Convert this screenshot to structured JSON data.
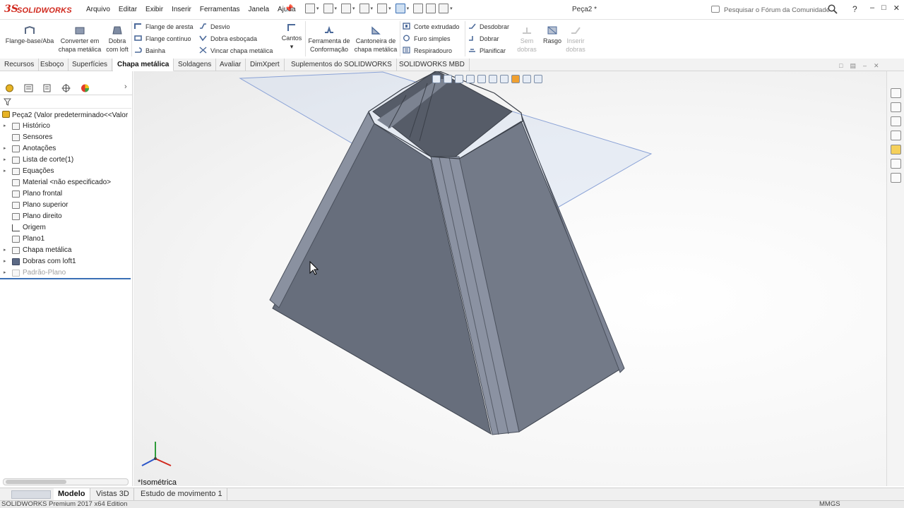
{
  "app": {
    "logo_mark": "3S",
    "logo_text": "SOLIDWORKS",
    "document_title": "Peça2 *",
    "search_placeholder": "Pesquisar o Fórum da Comunidade",
    "help_label": "?"
  },
  "menu": [
    "Arquivo",
    "Editar",
    "Exibir",
    "Inserir",
    "Ferramentas",
    "Janela",
    "Ajuda"
  ],
  "commands": {
    "flange_base": "Flange-base/Aba",
    "converter_1": "Converter em",
    "converter_2": "chapa metálica",
    "dobra_loft_1": "Dobra",
    "dobra_loft_2": "com loft",
    "flange_aresta": "Flange de aresta",
    "flange_continuo": "Flange contínuo",
    "bainha": "Bainha",
    "desvio": "Desvio",
    "dobra_esbocada": "Dobra esboçada",
    "vincar": "Vincar chapa metálica",
    "cantos": "Cantos",
    "ferramenta_1": "Ferramenta de",
    "ferramenta_2": "Conformação",
    "cantoneira_1": "Cantoneira de",
    "cantoneira_2": "chapa metálica",
    "corte_extrudado": "Corte extrudado",
    "furo_simples": "Furo simples",
    "respiradouro": "Respiradouro",
    "desdobrar": "Desdobrar",
    "dobrar": "Dobrar",
    "planificar": "Planificar",
    "sem_dobras_1": "Sem",
    "sem_dobras_2": "dobras",
    "rasgo": "Rasgo",
    "inserir_dobras_1": "Inserir",
    "inserir_dobras_2": "dobras"
  },
  "tabs": [
    "Recursos",
    "Esboço",
    "Superfícies",
    "Chapa metálica",
    "Soldagens",
    "Avaliar",
    "DimXpert",
    "Suplementos do SOLIDWORKS",
    "SOLIDWORKS MBD"
  ],
  "active_tab": "Chapa metálica",
  "tree": {
    "root": "Peça2  (Valor predeterminado<<Valor",
    "items": [
      {
        "label": "Histórico",
        "expandable": true
      },
      {
        "label": "Sensores",
        "expandable": false
      },
      {
        "label": "Anotações",
        "expandable": true
      },
      {
        "label": "Lista de corte(1)",
        "expandable": true
      },
      {
        "label": "Equações",
        "expandable": true
      },
      {
        "label": "Material <não especificado>",
        "expandable": false
      },
      {
        "label": "Plano frontal",
        "expandable": false
      },
      {
        "label": "Plano superior",
        "expandable": false
      },
      {
        "label": "Plano direito",
        "expandable": false
      },
      {
        "label": "Origem",
        "expandable": false
      },
      {
        "label": "Plano1",
        "expandable": false
      },
      {
        "label": "Chapa metálica",
        "expandable": true
      },
      {
        "label": "Dobras com loft1",
        "expandable": true
      },
      {
        "label": "Padrão-Plano",
        "expandable": true,
        "dimmed": true
      }
    ]
  },
  "viewport": {
    "view_name": "*Isométrica"
  },
  "bottom_tabs": [
    "Modelo",
    "Vistas 3D",
    "Estudo de movimento 1"
  ],
  "status": {
    "edition": "SOLIDWORKS Premium 2017 x64 Edition",
    "units": "MMGS"
  },
  "colors": {
    "brand_red": "#d0281d",
    "selection_blue": "#3a6fb5",
    "part_face": "#6c7382"
  }
}
